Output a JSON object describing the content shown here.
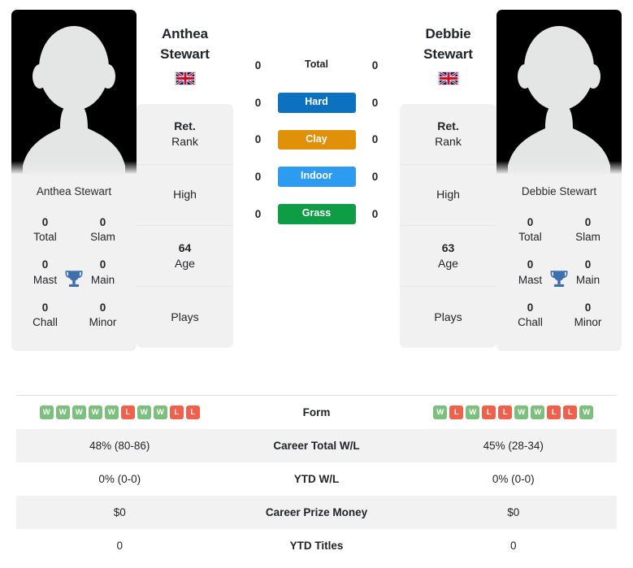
{
  "players": {
    "left": {
      "first_name": "Anthea",
      "last_name": "Stewart",
      "full_name": "Anthea Stewart",
      "country_flag": "uk-flag-icon",
      "photo": "player-photo-placeholder",
      "titles": [
        {
          "value": "0",
          "label": "Total"
        },
        {
          "value": "0",
          "label": "Slam"
        },
        {
          "value": "0",
          "label": "Mast"
        },
        {
          "value": "0",
          "label": "Main"
        },
        {
          "value": "0",
          "label": "Chall"
        },
        {
          "value": "0",
          "label": "Minor"
        }
      ],
      "trophy_icon": "trophy-icon",
      "info": [
        {
          "value": "Ret.",
          "label": "Rank"
        },
        {
          "value": "",
          "label": "High"
        },
        {
          "value": "64",
          "label": "Age"
        },
        {
          "value": "",
          "label": "Plays"
        }
      ],
      "surface_wins": {
        "total": "0",
        "hard": "0",
        "clay": "0",
        "indoor": "0",
        "grass": "0"
      },
      "form": [
        "W",
        "W",
        "W",
        "W",
        "W",
        "L",
        "W",
        "W",
        "L",
        "L"
      ],
      "career_total_wl": "48% (80-86)",
      "ytd_wl": "0% (0-0)",
      "career_prize_money": "$0",
      "ytd_titles": "0"
    },
    "right": {
      "first_name": "Debbie",
      "last_name": "Stewart",
      "full_name": "Debbie Stewart",
      "country_flag": "uk-flag-icon",
      "photo": "player-photo-placeholder",
      "titles": [
        {
          "value": "0",
          "label": "Total"
        },
        {
          "value": "0",
          "label": "Slam"
        },
        {
          "value": "0",
          "label": "Mast"
        },
        {
          "value": "0",
          "label": "Main"
        },
        {
          "value": "0",
          "label": "Chall"
        },
        {
          "value": "0",
          "label": "Minor"
        }
      ],
      "trophy_icon": "trophy-icon",
      "info": [
        {
          "value": "Ret.",
          "label": "Rank"
        },
        {
          "value": "",
          "label": "High"
        },
        {
          "value": "63",
          "label": "Age"
        },
        {
          "value": "",
          "label": "Plays"
        }
      ],
      "surface_wins": {
        "total": "0",
        "hard": "0",
        "clay": "0",
        "indoor": "0",
        "grass": "0"
      },
      "form": [
        "W",
        "L",
        "W",
        "L",
        "L",
        "W",
        "W",
        "L",
        "L",
        "W"
      ],
      "career_total_wl": "45% (28-34)",
      "ytd_wl": "0% (0-0)",
      "career_prize_money": "$0",
      "ytd_titles": "0"
    }
  },
  "surfaces": [
    {
      "key": "total",
      "label": "Total",
      "color": "transparent"
    },
    {
      "key": "hard",
      "label": "Hard",
      "color": "#0c72c0"
    },
    {
      "key": "clay",
      "label": "Clay",
      "color": "#e09009"
    },
    {
      "key": "indoor",
      "label": "Indoor",
      "color": "#2c9bf0"
    },
    {
      "key": "grass",
      "label": "Grass",
      "color": "#0e9c44"
    }
  ],
  "stats_rows": [
    {
      "label": "Form"
    },
    {
      "label": "Career Total W/L"
    },
    {
      "label": "YTD W/L"
    },
    {
      "label": "Career Prize Money"
    },
    {
      "label": "YTD Titles"
    }
  ],
  "colors": {
    "win_badge": "#7dbf7d",
    "loss_badge": "#f0604d",
    "card_bg": "#f1f1f1",
    "row_alt_bg": "#f2f2f2",
    "trophy": "#3e6faf"
  }
}
